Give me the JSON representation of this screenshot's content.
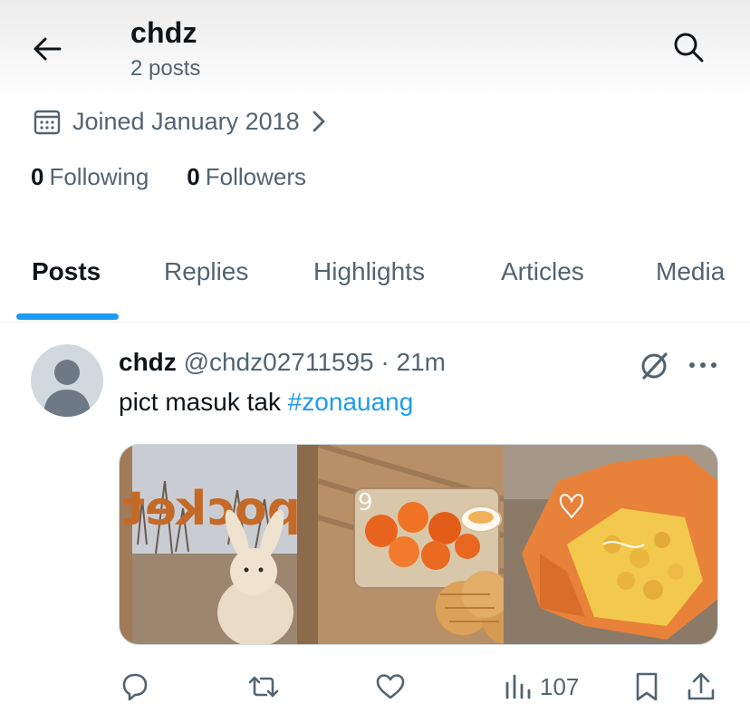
{
  "header": {
    "title": "chdz",
    "subtitle": "2 posts"
  },
  "profile": {
    "joined": "Joined January 2018",
    "following_count": "0",
    "following_label": "Following",
    "followers_count": "0",
    "followers_label": "Followers"
  },
  "tabs": [
    {
      "label": "Posts",
      "active": true
    },
    {
      "label": "Replies",
      "active": false
    },
    {
      "label": "Highlights",
      "active": false
    },
    {
      "label": "Articles",
      "active": false
    },
    {
      "label": "Media",
      "active": false
    }
  ],
  "post": {
    "name": "chdz",
    "handle": "@chdz02711595",
    "separator": "·",
    "time": "21m",
    "text": "pict masuk tak ",
    "hashtag": "#zonauang",
    "media": {
      "sign_text": "pocket"
    },
    "views": "107"
  },
  "icons": {
    "back": "arrow-left-icon",
    "search": "search-icon",
    "calendar": "calendar-icon",
    "chevron": "chevron-right-icon",
    "grok": "grok-icon",
    "more": "more-icon",
    "reply": "reply-icon",
    "repost": "repost-icon",
    "like": "like-icon",
    "views": "views-icon",
    "bookmark": "bookmark-icon",
    "share": "share-icon"
  },
  "colors": {
    "accent": "#1d9bf0",
    "text": "#0f1419",
    "secondary": "#536471",
    "divider": "#eff3f4"
  }
}
